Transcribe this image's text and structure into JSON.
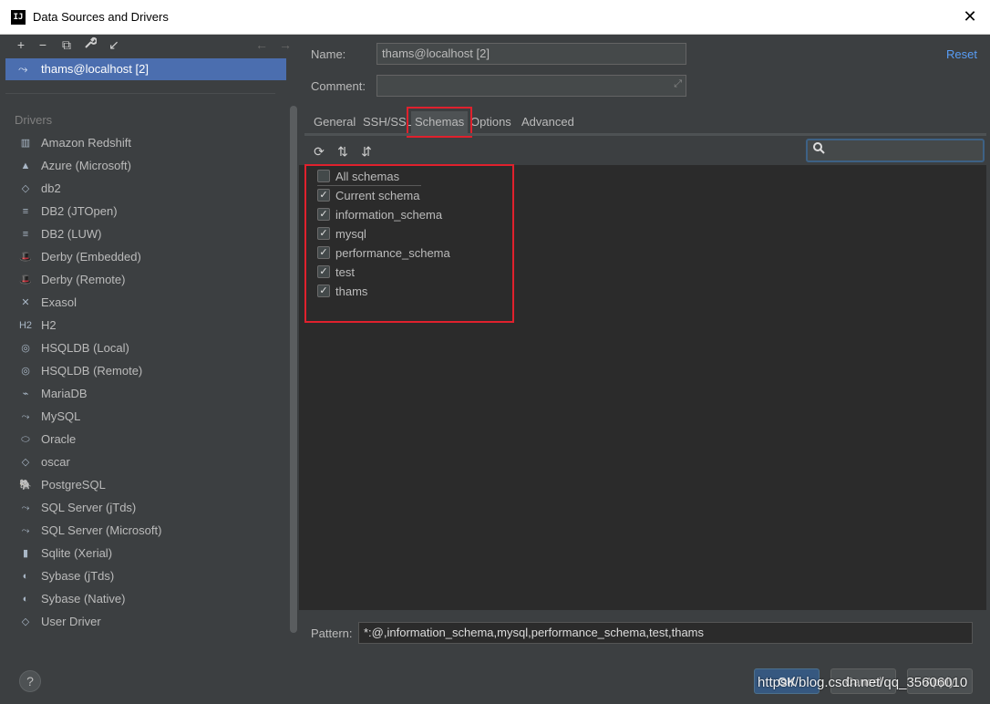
{
  "window": {
    "title": "Data Sources and Drivers",
    "app_icon": "IJ"
  },
  "left": {
    "toolbar": {
      "add": "+",
      "remove": "−",
      "copy": "⧉",
      "settings": "🔧",
      "import": "↙",
      "back": "←",
      "forward": "→"
    },
    "data_source": {
      "label": "thams@localhost [2]"
    },
    "drivers_heading": "Drivers",
    "drivers": [
      {
        "label": "Amazon Redshift",
        "icon": "redshift-icon",
        "glyph": "▥"
      },
      {
        "label": "Azure (Microsoft)",
        "icon": "azure-icon",
        "glyph": "▲"
      },
      {
        "label": "db2",
        "icon": "db2-icon",
        "glyph": "◇"
      },
      {
        "label": "DB2 (JTOpen)",
        "icon": "ibm-db2-icon",
        "glyph": "≡"
      },
      {
        "label": "DB2 (LUW)",
        "icon": "ibm-db2-icon",
        "glyph": "≡"
      },
      {
        "label": "Derby (Embedded)",
        "icon": "derby-icon",
        "glyph": "🎩"
      },
      {
        "label": "Derby (Remote)",
        "icon": "derby-icon",
        "glyph": "🎩"
      },
      {
        "label": "Exasol",
        "icon": "exasol-icon",
        "glyph": "✕"
      },
      {
        "label": "H2",
        "icon": "h2-icon",
        "glyph": "H2"
      },
      {
        "label": "HSQLDB (Local)",
        "icon": "hsqldb-icon",
        "glyph": "◎"
      },
      {
        "label": "HSQLDB (Remote)",
        "icon": "hsqldb-icon",
        "glyph": "◎"
      },
      {
        "label": "MariaDB",
        "icon": "mariadb-icon",
        "glyph": "⌁"
      },
      {
        "label": "MySQL",
        "icon": "mysql-icon",
        "glyph": "⤳"
      },
      {
        "label": "Oracle",
        "icon": "oracle-icon",
        "glyph": "⬭"
      },
      {
        "label": "oscar",
        "icon": "oscar-icon",
        "glyph": "◇"
      },
      {
        "label": "PostgreSQL",
        "icon": "postgresql-icon",
        "glyph": "🐘"
      },
      {
        "label": "SQL Server (jTds)",
        "icon": "sqlserver-icon",
        "glyph": "⤳"
      },
      {
        "label": "SQL Server (Microsoft)",
        "icon": "sqlserver-icon",
        "glyph": "⤳"
      },
      {
        "label": "Sqlite (Xerial)",
        "icon": "sqlite-icon",
        "glyph": "▮"
      },
      {
        "label": "Sybase (jTds)",
        "icon": "sybase-icon",
        "glyph": "◐"
      },
      {
        "label": "Sybase (Native)",
        "icon": "sybase-icon",
        "glyph": "◐"
      },
      {
        "label": "User Driver",
        "icon": "user-driver-icon",
        "glyph": "◇"
      }
    ]
  },
  "form": {
    "name_label": "Name:",
    "name_value": "thams@localhost [2]",
    "comment_label": "Comment:",
    "comment_value": "",
    "reset": "Reset"
  },
  "tabs": [
    {
      "label": "General",
      "active": false
    },
    {
      "label": "SSH/SSL",
      "active": false
    },
    {
      "label": "Schemas",
      "active": true
    },
    {
      "label": "Options",
      "active": false
    },
    {
      "label": "Advanced",
      "active": false
    }
  ],
  "schemas_toolbar": {
    "refresh": "⟳",
    "expand": "⇅",
    "collapse": "⇵",
    "search_icon": "🔍"
  },
  "schemas": [
    {
      "label": "All schemas",
      "checked": false
    },
    {
      "label": "Current schema",
      "checked": true
    },
    {
      "label": "information_schema",
      "checked": true
    },
    {
      "label": "mysql",
      "checked": true
    },
    {
      "label": "performance_schema",
      "checked": true
    },
    {
      "label": "test",
      "checked": true
    },
    {
      "label": "thams",
      "checked": true
    }
  ],
  "pattern": {
    "label": "Pattern:",
    "value": "*:@,information_schema,mysql,performance_schema,test,thams"
  },
  "buttons": {
    "help": "?",
    "ok": "OK",
    "cancel": "Cancel",
    "apply": "Apply"
  },
  "watermark": "https://blog.csdn.net/qq_35606010",
  "colors": {
    "accent": "#4b6eaf",
    "highlight_box": "#e0212d",
    "link": "#589df6"
  }
}
